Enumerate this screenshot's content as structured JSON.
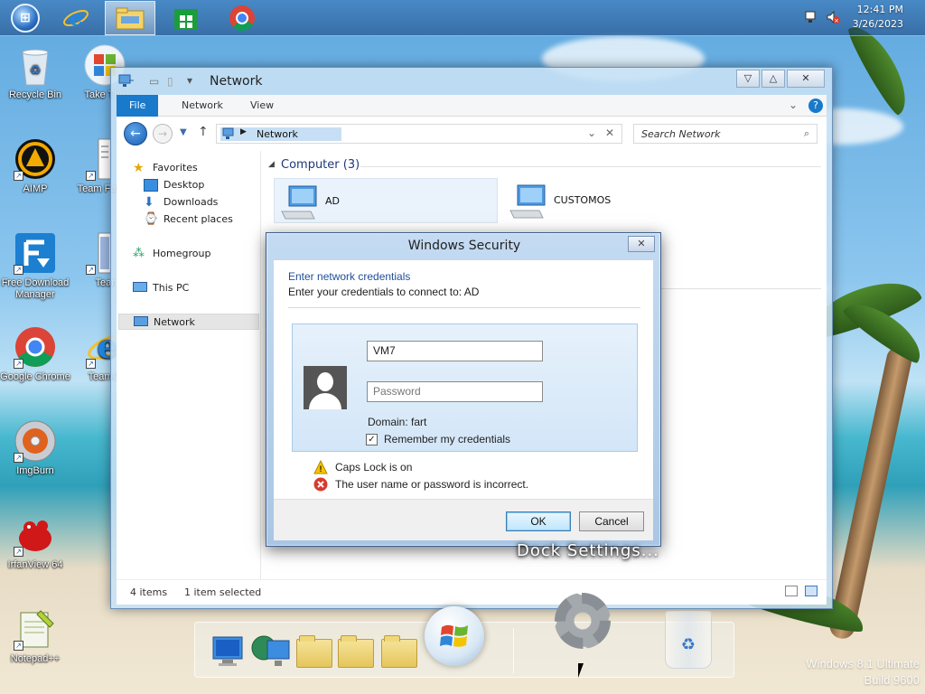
{
  "taskbar": {
    "clock_time": "12:41 PM",
    "clock_date": "3/26/2023",
    "pinned": [
      "start-button",
      "internet-explorer-icon",
      "file-explorer-icon",
      "store-icon",
      "chrome-icon"
    ]
  },
  "desktop": {
    "icons": [
      {
        "label": "Recycle Bin",
        "icon": "recycle-bin-icon"
      },
      {
        "label": "Take The",
        "icon": "windows-flag-icon"
      },
      {
        "label": "AIMP",
        "icon": "aimp-icon"
      },
      {
        "label": "Team Facebo",
        "icon": "text-file-icon"
      },
      {
        "label": "Free Download Manager",
        "icon": "fdm-icon"
      },
      {
        "label": "Team",
        "icon": "text-file-icon"
      },
      {
        "label": "Google Chrome",
        "icon": "chrome-icon"
      },
      {
        "label": "TeamOS",
        "icon": "internet-explorer-icon"
      },
      {
        "label": "ImgBurn",
        "icon": "imgburn-icon"
      },
      {
        "label": "IrfanView 64",
        "icon": "irfanview-icon"
      },
      {
        "label": "Notepad++",
        "icon": "notepadpp-icon"
      }
    ]
  },
  "explorer": {
    "title": "Network",
    "ribbon_tabs": [
      "File",
      "Network",
      "View"
    ],
    "address": "Network",
    "search_placeholder": "Search Network",
    "nav": {
      "favorites": "Favorites",
      "desktop": "Desktop",
      "downloads": "Downloads",
      "recent": "Recent places",
      "homegroup": "Homegroup",
      "this_pc": "This PC",
      "network": "Network"
    },
    "group_header": "Computer (3)",
    "computers": [
      "AD",
      "CUSTOMOS"
    ],
    "status": {
      "items": "4 items",
      "selected": "1 item selected"
    }
  },
  "dialog": {
    "title": "Windows Security",
    "heading": "Enter network credentials",
    "subheading": "Enter your credentials to connect to: AD",
    "username_value": "VM7",
    "password_placeholder": "Password",
    "domain": "Domain: fart",
    "remember_label": "Remember my credentials",
    "remember_checked": true,
    "warning": "Caps Lock is on",
    "error": "The user name or password is incorrect.",
    "ok_label": "OK",
    "cancel_label": "Cancel"
  },
  "dock": {
    "label": "Dock Settings...",
    "items": [
      "monitor-icon",
      "network-globe-icon",
      "documents-folder-icon",
      "music-folder-icon",
      "pictures-folder-icon",
      "windows-orb-icon",
      "settings-gear-icon",
      "recycle-bin-icon"
    ]
  },
  "watermark": {
    "line1": "Windows 8.1 Ultimate",
    "line2": "Build 9600"
  },
  "colors": {
    "accent": "#1979ca",
    "link_blue": "#1f4e9b",
    "error_red": "#d83b2d",
    "warning_yellow": "#f5c400"
  }
}
